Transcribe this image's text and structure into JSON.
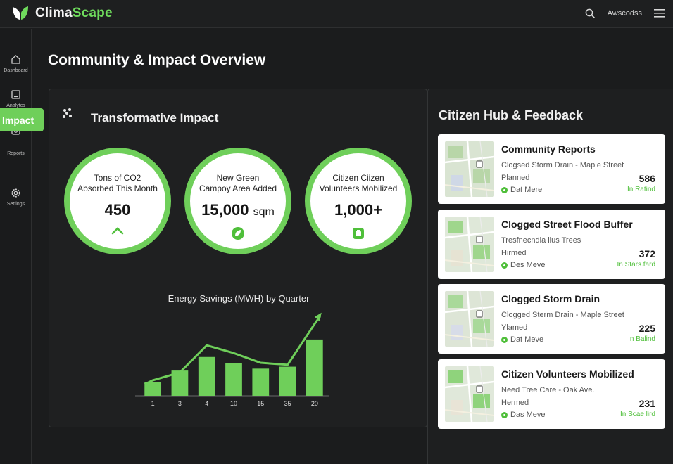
{
  "app": {
    "name_primary": "Clima",
    "name_accent": "Scape",
    "user": "Awscodss"
  },
  "colors": {
    "accent": "#6fcf5a",
    "background": "#1b1c1d",
    "panel": "#1f2021"
  },
  "sidebar": {
    "items": [
      {
        "label": "Dashboard",
        "icon": "home-icon"
      },
      {
        "label": "Analytcs",
        "icon": "tablet-icon"
      },
      {
        "label": "Reports",
        "icon": "camera-icon"
      },
      {
        "label": "Settings",
        "icon": "gear-icon"
      }
    ],
    "active_label": "Impact"
  },
  "page": {
    "title": "Community & Impact Overview"
  },
  "impact": {
    "title": "Transformative Impact",
    "metrics": [
      {
        "label_line1": "Tons of CO2",
        "label_line2": "Absorbed This Month",
        "value": "450",
        "unit": "",
        "icon": "chevron-up-icon"
      },
      {
        "label_line1": "New Green",
        "label_line2": "Campoy Area Added",
        "value": "15,000",
        "unit": "sqm",
        "icon": "leaf-icon"
      },
      {
        "label_line1": "Citizen Ciizen",
        "label_line2": "Volunteers Mobilized",
        "value": "1,000+",
        "unit": "",
        "icon": "badge-icon"
      }
    ]
  },
  "chart_data": {
    "type": "bar",
    "title": "Energy Savings (MWH) by Quarter",
    "categories": [
      "1",
      "3",
      "4",
      "10",
      "15",
      "35",
      "20"
    ],
    "values": [
      7,
      13,
      20,
      17,
      14,
      15,
      29
    ],
    "trend": [
      8,
      12,
      26,
      22,
      17,
      16,
      37
    ],
    "ylim": [
      0,
      42
    ]
  },
  "hub": {
    "title": "Citizen Hub & Feedback",
    "cards": [
      {
        "title": "Community Reports",
        "sub": "Clogsed Storm Drain - Maple Street",
        "status": "Planned",
        "location": "Dat Mere",
        "count": "586",
        "tag": "In Ratind"
      },
      {
        "title": "Clogged Street Flood Buffer",
        "sub": "Tresfnecndla llus Trees",
        "status": "Hirmed",
        "location": "Des Meve",
        "count": "372",
        "tag": "In Stars.fard"
      },
      {
        "title": "Clogged Storm Drain",
        "sub": "Clogged Sterm Drain - Maple Street",
        "status": "Ylamed",
        "location": "Dat Meve",
        "count": "225",
        "tag": "In Balind"
      },
      {
        "title": "Citizen Volunteers Mobilized",
        "sub": "Need Tree Care - Oak Ave.",
        "status": "Hermed",
        "location": "Das Meve",
        "count": "231",
        "tag": "In Scae lird"
      }
    ]
  }
}
